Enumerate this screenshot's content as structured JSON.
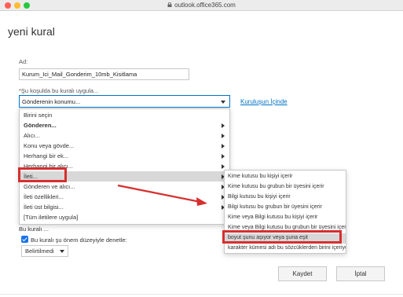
{
  "browser": {
    "url": "outlook.office365.com"
  },
  "dialog": {
    "title": "yeni kural"
  },
  "name_field": {
    "label": "Ad:",
    "value": "Kurum_Ici_Mail_Gonderim_10mb_Kisitlama"
  },
  "condition": {
    "label": "*Şu koşulda bu kuralı uygula...",
    "selected": "Gönderenin konumu...",
    "org_link": "Kuruluşun İçinde"
  },
  "menu": {
    "items": [
      {
        "label": "Birini seçin",
        "has_submenu": false
      },
      {
        "label": "Gönderen...",
        "has_submenu": true
      },
      {
        "label": "Alıcı...",
        "has_submenu": true
      },
      {
        "label": "Konu veya gövde...",
        "has_submenu": true
      },
      {
        "label": "Herhangi bir ek...",
        "has_submenu": true
      },
      {
        "label": "Herhangi bir alıcı...",
        "has_submenu": true
      },
      {
        "label": "İleti...",
        "has_submenu": true
      },
      {
        "label": "Gönderen ve alıcı...",
        "has_submenu": true
      },
      {
        "label": "İleti özellikleri...",
        "has_submenu": true
      },
      {
        "label": "İleti üst bilgisi...",
        "has_submenu": true
      },
      {
        "label": "[Tüm iletilere uygula]",
        "has_submenu": false
      }
    ]
  },
  "submenu": {
    "items": [
      "Kime kutusu bu kişiyi içerir",
      "Kime kutusu bu grubun bir üyesini içerir",
      "Bilgi kutusu bu kişiyi içerir",
      "Bilgi kutusu bu grubun bir üyesini içerir",
      "Kime veya Bilgi kutusu bu kişiyi içerir",
      "Kime veya Bilgi kutusu bu grubun bir üyesini içerir",
      "boyut şunu aşıyor veya şuna eşit",
      "karakter kümesi adı bu sözcüklerden birini içeriyor"
    ]
  },
  "partial_label": "Bu kuralı ...",
  "importance": {
    "checkbox_label": "Bu kuralı şu önem düzeyiyle denetle:",
    "checked": true,
    "selected": "Belirtilmedi"
  },
  "buttons": {
    "save": "Kaydet",
    "cancel": "İptal"
  },
  "colors": {
    "accent": "#0072c6",
    "highlight": "#d62f2f",
    "checkbox": "#1a73e8"
  }
}
